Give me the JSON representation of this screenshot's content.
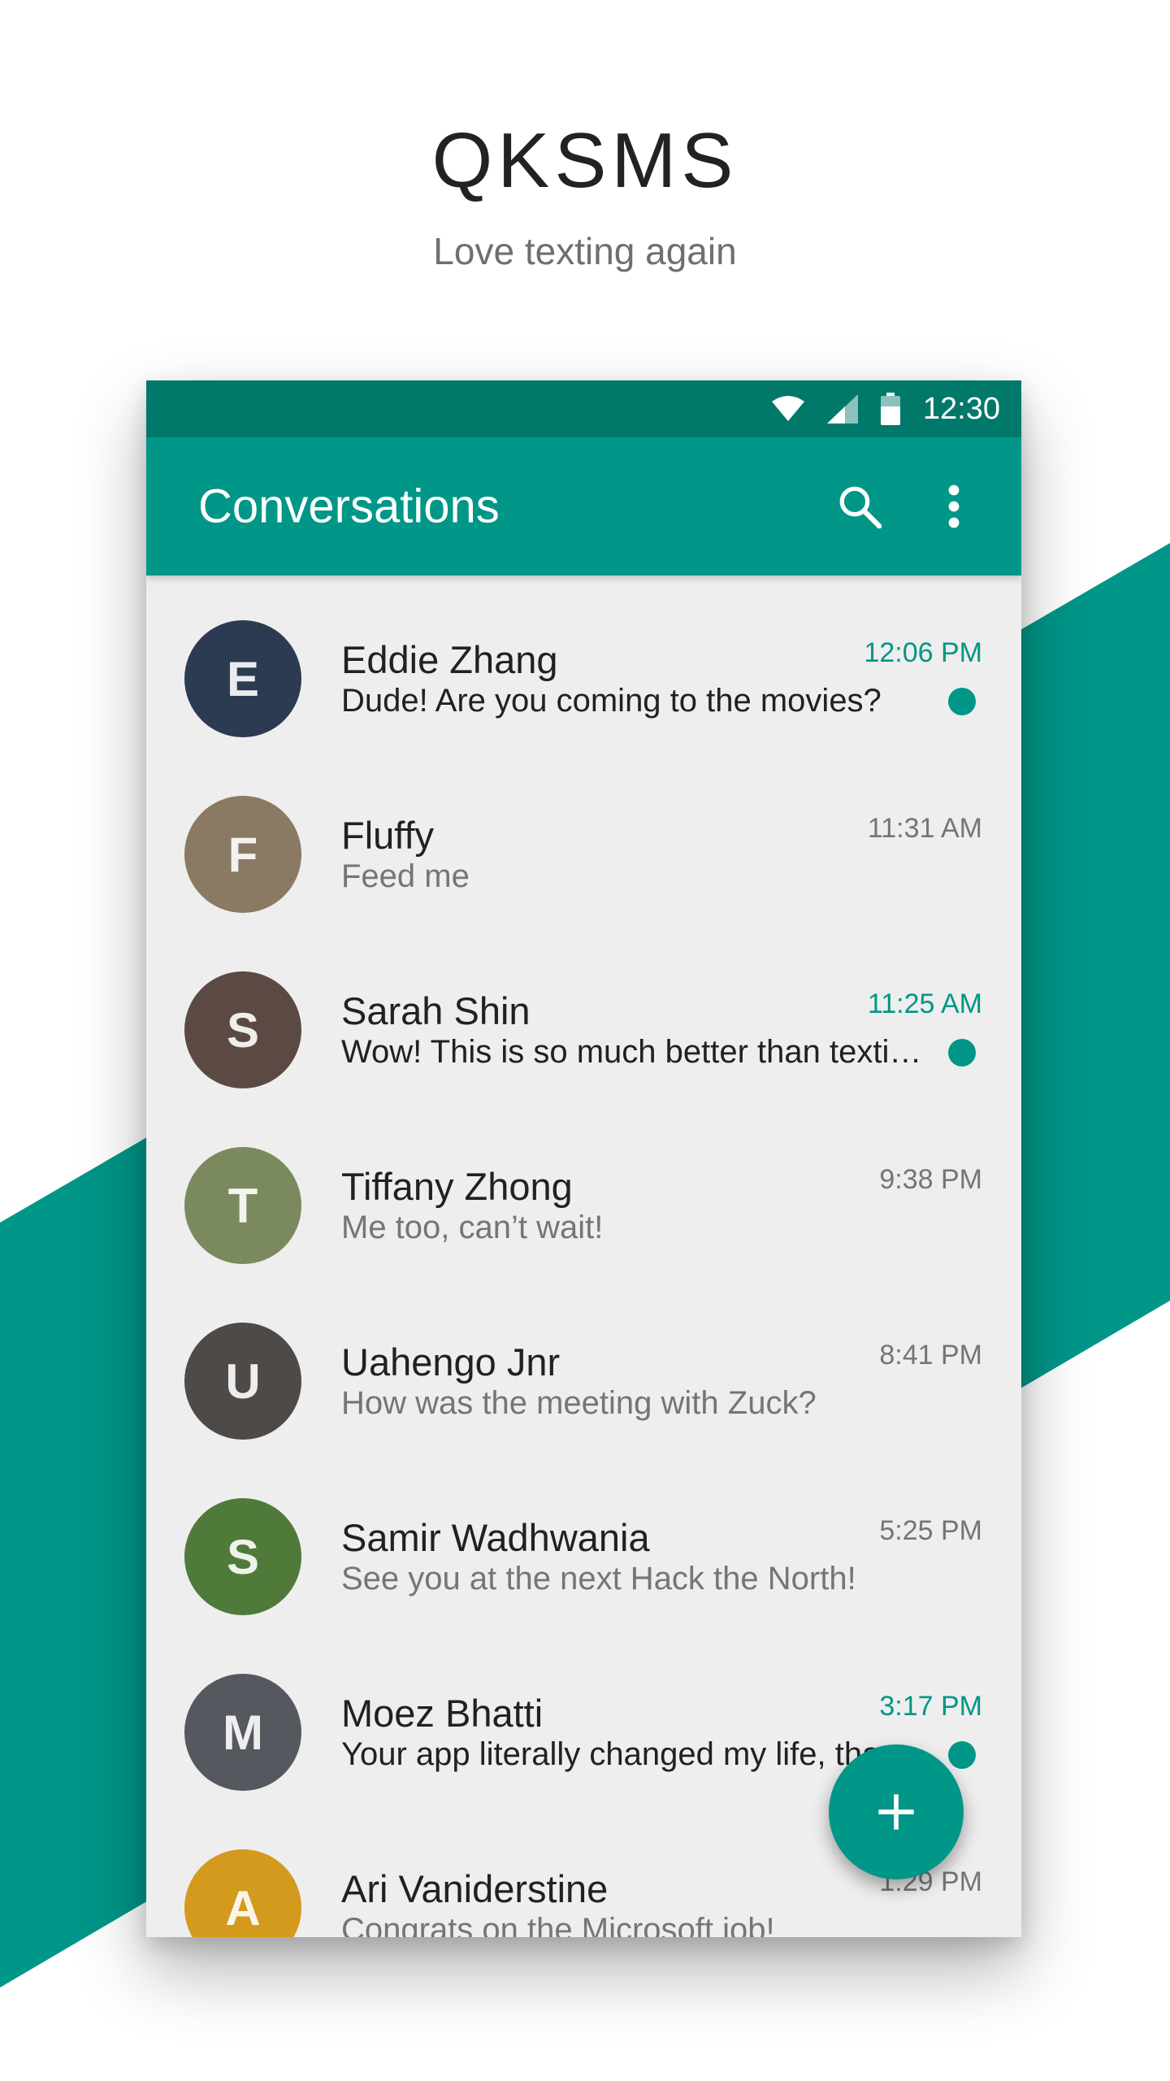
{
  "hero": {
    "title": "QKSMS",
    "subtitle": "Love texting again"
  },
  "colors": {
    "accent": "#009688",
    "accent_dark": "#00796b",
    "background_list": "#eeeeee"
  },
  "status_bar": {
    "time": "12:30",
    "icons": [
      "wifi-icon",
      "signal-icon",
      "battery-icon"
    ]
  },
  "app_bar": {
    "title": "Conversations",
    "actions": [
      "search-icon",
      "more-vert-icon"
    ]
  },
  "conversations": [
    {
      "name": "Eddie Zhang",
      "preview": "Dude! Are you coming to the movies?",
      "time": "12:06 PM",
      "unread": true,
      "avatar_color": "#2c3a52",
      "initial": "E"
    },
    {
      "name": "Fluffy",
      "preview": "Feed me",
      "time": "11:31 AM",
      "unread": false,
      "avatar_color": "#8a7a63",
      "initial": "F"
    },
    {
      "name": "Sarah Shin",
      "preview": "Wow! This is so much better than texting on my old app!",
      "time": "11:25 AM",
      "unread": true,
      "avatar_color": "#5b4a44",
      "initial": "S"
    },
    {
      "name": "Tiffany Zhong",
      "preview": "Me too, can’t wait!",
      "time": "9:38 PM",
      "unread": false,
      "avatar_color": "#7a8a5e",
      "initial": "T"
    },
    {
      "name": "Uahengo Jnr",
      "preview": "How was the meeting with Zuck?",
      "time": "8:41 PM",
      "unread": false,
      "avatar_color": "#4e4a48",
      "initial": "U"
    },
    {
      "name": "Samir Wadhwania",
      "preview": "See you at the next Hack the North!",
      "time": "5:25 PM",
      "unread": false,
      "avatar_color": "#4f7a3a",
      "initial": "S"
    },
    {
      "name": "Moez Bhatti",
      "preview": "Your app literally changed my life, thank you!",
      "time": "3:17 PM",
      "unread": true,
      "avatar_color": "#55585e",
      "initial": "M"
    },
    {
      "name": "Ari Vaniderstine",
      "preview": "Congrats on the Microsoft job!",
      "time": "1:29 PM",
      "unread": false,
      "avatar_color": "#d39a1e",
      "initial": "A"
    }
  ],
  "fab": {
    "icon": "plus-icon"
  }
}
